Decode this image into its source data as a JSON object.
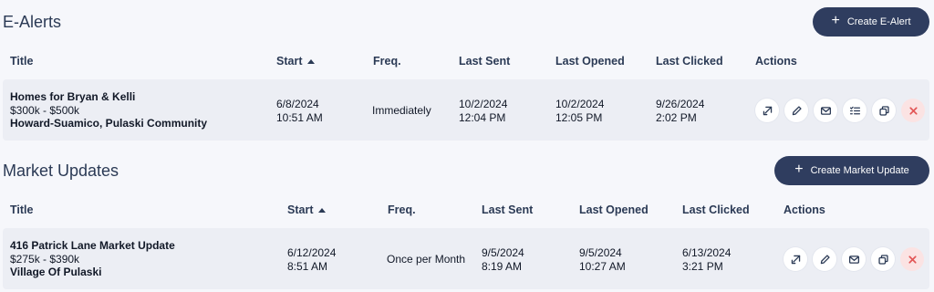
{
  "ealerts": {
    "title": "E-Alerts",
    "create_label": "Create E-Alert",
    "columns": {
      "title": "Title",
      "start": "Start",
      "freq": "Freq.",
      "last_sent": "Last Sent",
      "last_opened": "Last Opened",
      "last_clicked": "Last Clicked",
      "actions": "Actions"
    },
    "row": {
      "name": "Homes for Bryan & Kelli",
      "price": "$300k - $500k",
      "area": "Howard-Suamico, Pulaski Community",
      "start_date": "6/8/2024",
      "start_time": "10:51 AM",
      "freq": "Immediately",
      "sent_date": "10/2/2024",
      "sent_time": "12:04 PM",
      "opened_date": "10/2/2024",
      "opened_time": "12:05 PM",
      "clicked_date": "9/26/2024",
      "clicked_time": "2:02 PM"
    }
  },
  "market": {
    "title": "Market Updates",
    "create_label": "Create Market Update",
    "columns": {
      "title": "Title",
      "start": "Start",
      "freq": "Freq.",
      "last_sent": "Last Sent",
      "last_opened": "Last Opened",
      "last_clicked": "Last Clicked",
      "actions": "Actions"
    },
    "row": {
      "name": "416 Patrick Lane Market Update",
      "price": "$275k - $390k",
      "area": "Village Of Pulaski",
      "start_date": "6/12/2024",
      "start_time": "8:51 AM",
      "freq": "Once per Month",
      "sent_date": "9/5/2024",
      "sent_time": "8:19 AM",
      "opened_date": "9/5/2024",
      "opened_time": "10:27 AM",
      "clicked_date": "6/13/2024",
      "clicked_time": "3:21 PM"
    }
  },
  "icons": {
    "plus": "plus-icon",
    "share": "share-arrow-icon",
    "edit": "pencil-icon",
    "email": "envelope-icon",
    "checklist": "checklist-icon",
    "duplicate": "copy-icon",
    "delete": "close-icon",
    "sort": "sort-ascending-icon"
  },
  "colors": {
    "button_bg": "#2f3d5f",
    "row_bg": "#eceef4",
    "delete": "#e25555",
    "page_bg": "#f6f7fb"
  }
}
